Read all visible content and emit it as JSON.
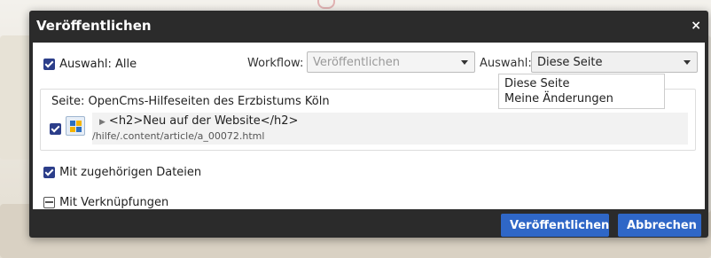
{
  "dialog": {
    "title": "Veröffentlichen",
    "close_icon": "×"
  },
  "top_row": {
    "select_all_label": "Auswahl: Alle",
    "workflow_label": "Workflow:",
    "workflow_value": "Veröffentlichen",
    "auswahl_label": "Auswahl:",
    "auswahl_value": "Diese Seite"
  },
  "dropdown_options": [
    "Diese Seite",
    "Meine Änderungen"
  ],
  "panel": {
    "title": "Seite: OpenCms-Hilfeseiten des Erzbistums Köln",
    "resource_title": "<h2>Neu auf der Website</h2>",
    "resource_path": "/hilfe/.content/article/a_00072.html"
  },
  "options": {
    "related_files": "Mit zugehörigen Dateien",
    "links": "Mit Verknüpfungen"
  },
  "buttons": {
    "publish": "Veröffentlichen",
    "cancel": "Abbrechen"
  },
  "colors": {
    "dialog_bg": "#2b2b2b",
    "button_blue": "#2f67c7",
    "checkbox_blue": "#2c3e8a"
  }
}
